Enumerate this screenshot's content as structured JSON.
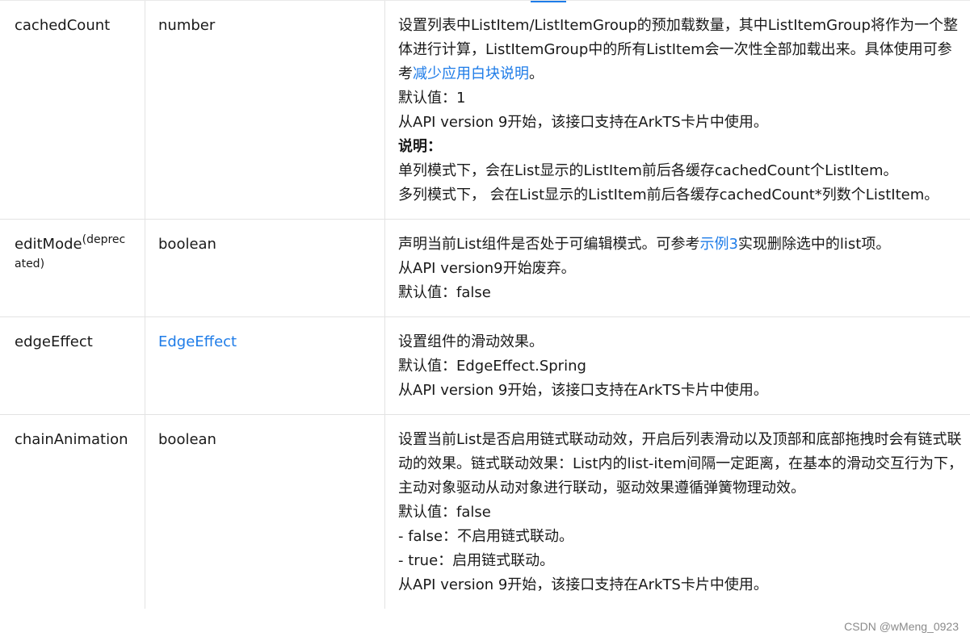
{
  "rows": [
    {
      "name": "cachedCount",
      "type": "number",
      "desc": {
        "p1_pre": "设置列表中ListItem/ListItemGroup的预加载数量，其中ListItemGroup将作为一个整体进行计算，ListItemGroup中的所有ListItem会一次性全部加载出来。具体使用可参考",
        "p1_link": "减少应用白块说明",
        "p1_post": "。",
        "default": "默认值：1",
        "since": "从API version 9开始，该接口支持在ArkTS卡片中使用。",
        "note_title": "说明：",
        "note1": "单列模式下，会在List显示的ListItem前后各缓存cachedCount个ListItem。",
        "note2": "多列模式下， 会在List显示的ListItem前后各缓存cachedCount*列数个ListItem。"
      }
    },
    {
      "name": "editMode",
      "name_sup": "(deprecated)",
      "type": "boolean",
      "desc": {
        "p1_pre": "声明当前List组件是否处于可编辑模式。可参考",
        "p1_link": "示例3",
        "p1_post": "实现删除选中的list项。",
        "deprecated": "从API version9开始废弃。",
        "default": "默认值：false"
      }
    },
    {
      "name": "edgeEffect",
      "type": "EdgeEffect",
      "desc": {
        "p1": "设置组件的滑动效果。",
        "default": "默认值：EdgeEffect.Spring",
        "since": "从API version 9开始，该接口支持在ArkTS卡片中使用。"
      }
    },
    {
      "name": "chainAnimation",
      "type": "boolean",
      "desc": {
        "p1": "设置当前List是否启用链式联动动效，开启后列表滑动以及顶部和底部拖拽时会有链式联动的效果。链式联动效果：List内的list-item间隔一定距离，在基本的滑动交互行为下，主动对象驱动从动对象进行联动，驱动效果遵循弹簧物理动效。",
        "default": "默认值：false",
        "opt_false": "- false：不启用链式联动。",
        "opt_true": "- true：启用链式联动。",
        "since": "从API version 9开始，该接口支持在ArkTS卡片中使用。"
      }
    }
  ],
  "watermark": "CSDN @wMeng_0923",
  "colors": {
    "link": "#1e7ce8",
    "border": "#e3e3e3",
    "text": "#191919"
  }
}
